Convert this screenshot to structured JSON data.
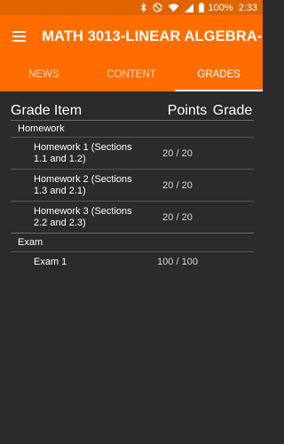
{
  "status_bar": {
    "battery": "100%",
    "time": "2:33",
    "icons": [
      "bluetooth-icon",
      "do-not-disturb-icon",
      "wifi-icon",
      "signal-icon",
      "battery-icon"
    ]
  },
  "app_bar": {
    "title": "MATH 3013-LINEAR ALGEBRA-...",
    "menu_icon": "hamburger-menu-icon"
  },
  "tabs": [
    {
      "label": "NEWS",
      "active": false
    },
    {
      "label": "CONTENT",
      "active": false
    },
    {
      "label": "GRADES",
      "active": true
    }
  ],
  "table": {
    "headers": {
      "item": "Grade Item",
      "points": "Points",
      "grade": "Grade"
    },
    "categories": [
      {
        "name": "Homework",
        "items": [
          {
            "name": "Homework 1 (Sections 1.1 and 1.2)",
            "points": "20 / 20",
            "grade": ""
          },
          {
            "name": "Homework 2 (Sections 1.3 and 2.1)",
            "points": "20 / 20",
            "grade": ""
          },
          {
            "name": "Homework 3 (Sections 2.2 and 2.3)",
            "points": "20 / 20",
            "grade": ""
          }
        ]
      },
      {
        "name": "Exam",
        "items": [
          {
            "name": "Exam 1",
            "points": "100 / 100",
            "grade": ""
          }
        ]
      }
    ]
  },
  "colors": {
    "accent": "#ff6d00",
    "status_bar": "#e06400",
    "background": "#2b2b2b"
  }
}
